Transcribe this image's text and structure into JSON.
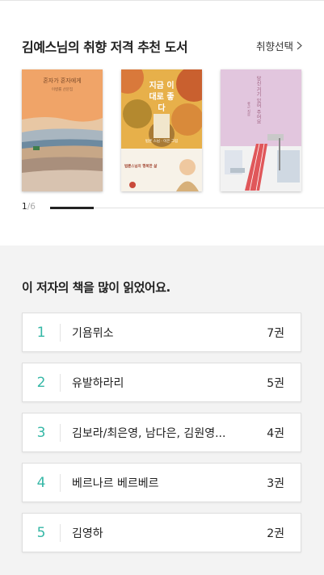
{
  "recommend": {
    "title": "김예스님의 취향 저격 추천 도서",
    "pref_link": "취향선택",
    "books": [
      {
        "title": "혼자가 혼자에게",
        "author": "이병률 산문집"
      },
      {
        "title": "지금 이대로 좋다",
        "author": "법륜 스님 · 이은 그림",
        "band": "법륜스님의 행복한 삶"
      },
      {
        "title": "당신 거기 있어 주어요",
        "author": "류근 지음"
      }
    ],
    "pager": {
      "current": "1",
      "total": "/6"
    }
  },
  "authors": {
    "title": "이 저자의 책을 많이 읽었어요.",
    "items": [
      {
        "rank": "1",
        "name": "기욤뮈소",
        "count": "7권"
      },
      {
        "rank": "2",
        "name": "유발하라리",
        "count": "5권"
      },
      {
        "rank": "3",
        "name": "김보라/최은영, 남다은, 김원영...",
        "count": "4권"
      },
      {
        "rank": "4",
        "name": "베르나르 베르베르",
        "count": "3권"
      },
      {
        "rank": "5",
        "name": "김영하",
        "count": "2권"
      }
    ]
  },
  "colors": {
    "accent": "#35b7a6"
  }
}
